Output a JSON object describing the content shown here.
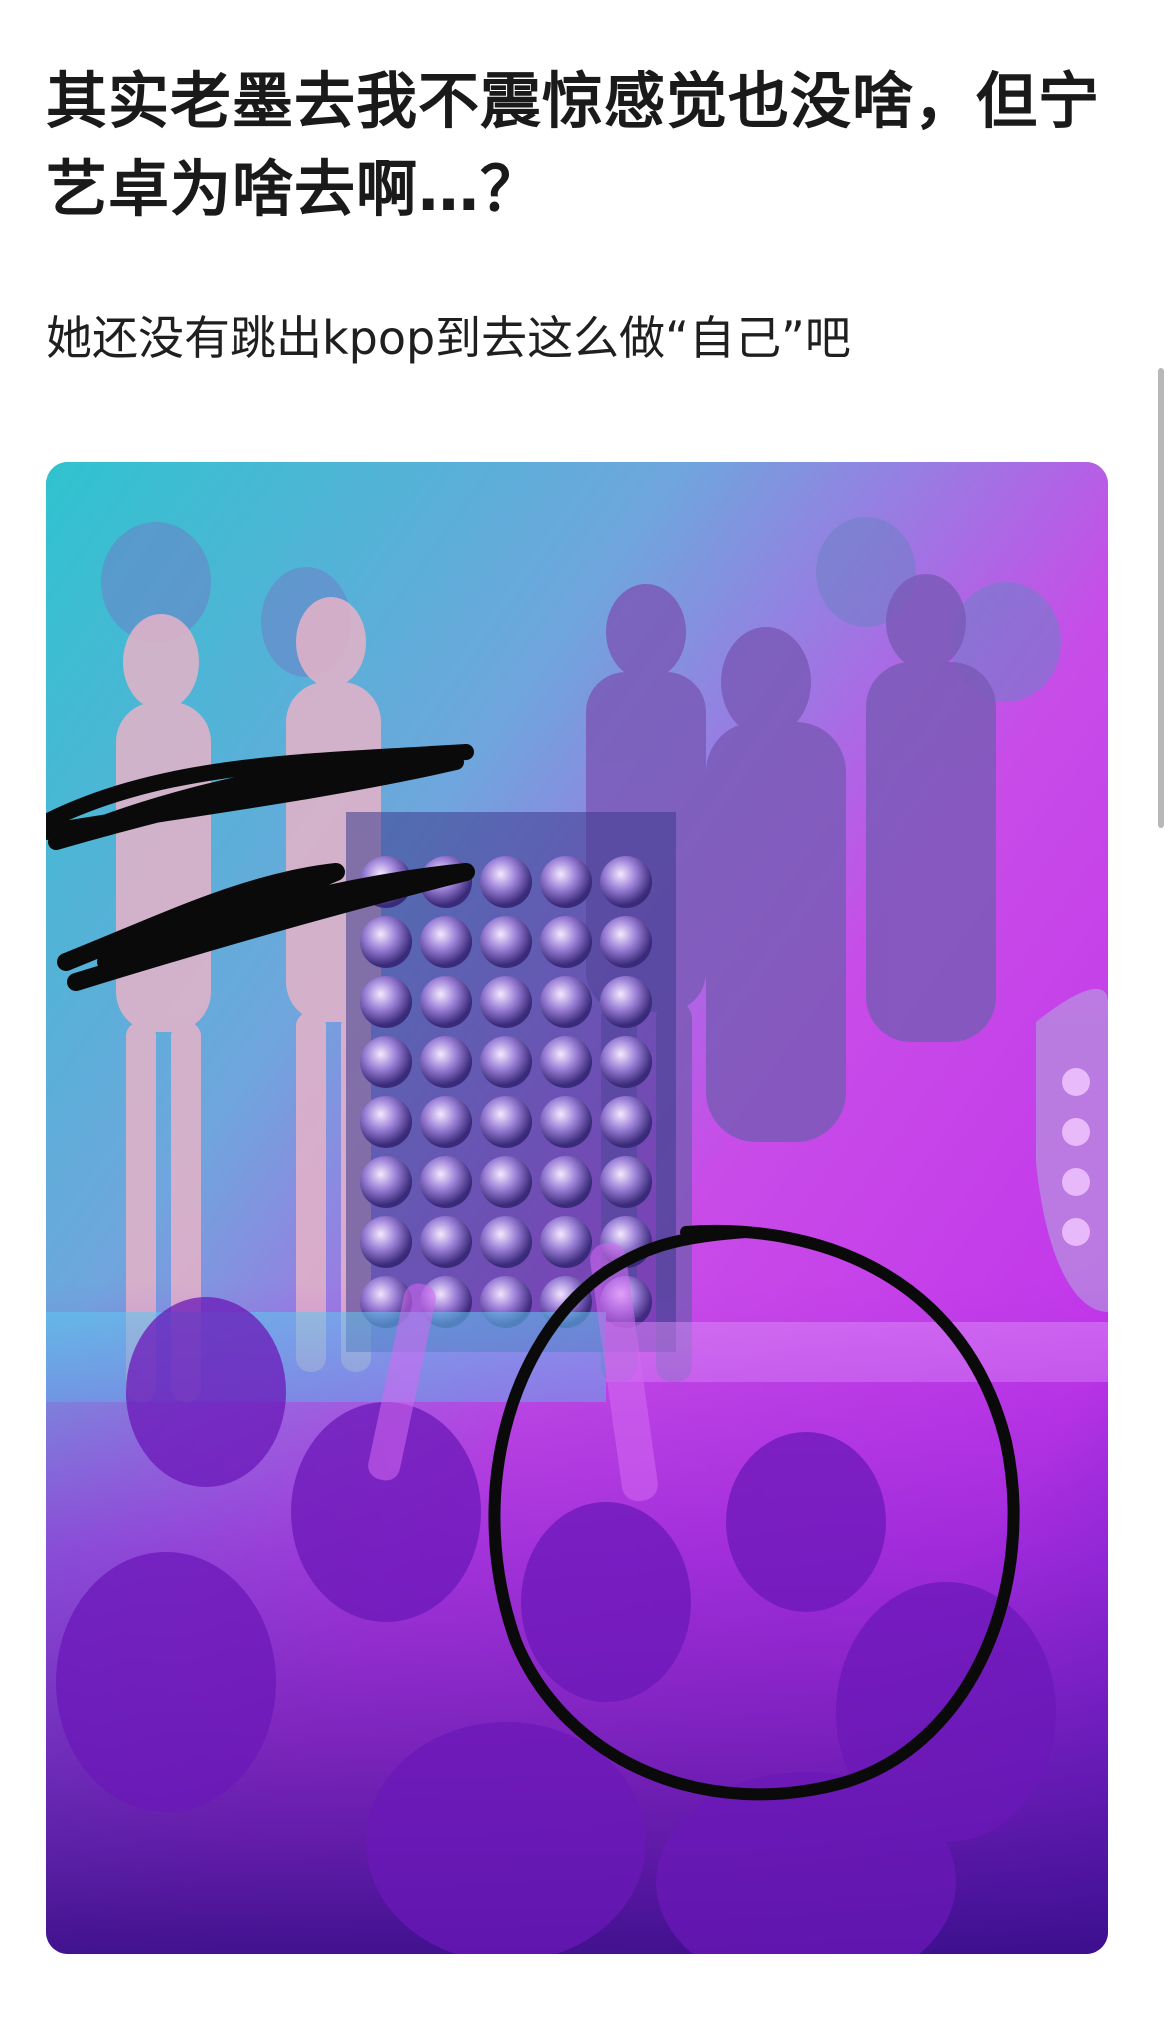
{
  "post": {
    "title": "其实老墨去我不震惊感觉也没啥，但宁艺卓为啥去啊…？",
    "body": "她还没有跳出kpop到去这么做“自己”吧"
  },
  "image": {
    "content": "nightclub-stage-photo",
    "annotations": [
      "black-scribble-redaction",
      "black-circle-highlight"
    ]
  },
  "colors": {
    "cyan": "#3fd0d8",
    "magenta": "#d23cf0",
    "purple": "#7a22e0",
    "ink": "#0a0a0a"
  }
}
